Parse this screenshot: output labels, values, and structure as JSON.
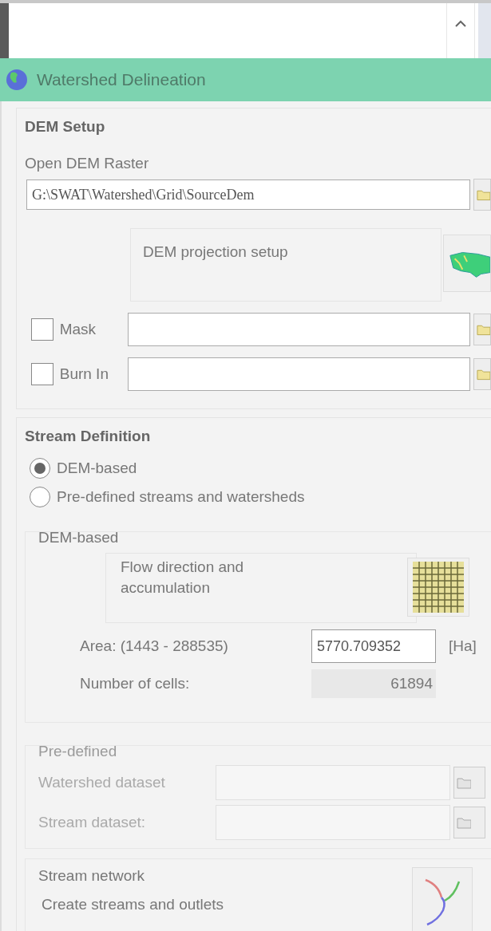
{
  "window": {
    "title": "Watershed Delineation"
  },
  "dem_setup": {
    "heading": "DEM Setup",
    "raster_label": "Open DEM Raster",
    "raster_path": "G:\\SWAT\\Watershed\\Grid\\SourceDem",
    "projection_label": "DEM projection setup",
    "options": [
      {
        "label": "Mask",
        "checked": false
      },
      {
        "label": "Burn In",
        "checked": false
      }
    ]
  },
  "stream_definition": {
    "heading": "Stream Definition",
    "methods": [
      {
        "label": "DEM-based",
        "selected": true
      },
      {
        "label": "Pre-defined streams and watersheds",
        "selected": false
      }
    ],
    "dem_based": {
      "legend": "DEM-based",
      "flow_label": "Flow direction and accumulation",
      "area_label": "Area: (1443 - 288535)",
      "area_value": "5770.709352",
      "unit": "[Ha]",
      "cells_label": "Number of cells:",
      "cells_value": "61894"
    },
    "predefined": {
      "legend": "Pre-defined",
      "disabled": true,
      "fields": [
        {
          "label": "Watershed dataset"
        },
        {
          "label": "Stream dataset:"
        }
      ]
    }
  },
  "stream_network": {
    "legend": "Stream network",
    "action_label": "Create streams and outlets"
  }
}
